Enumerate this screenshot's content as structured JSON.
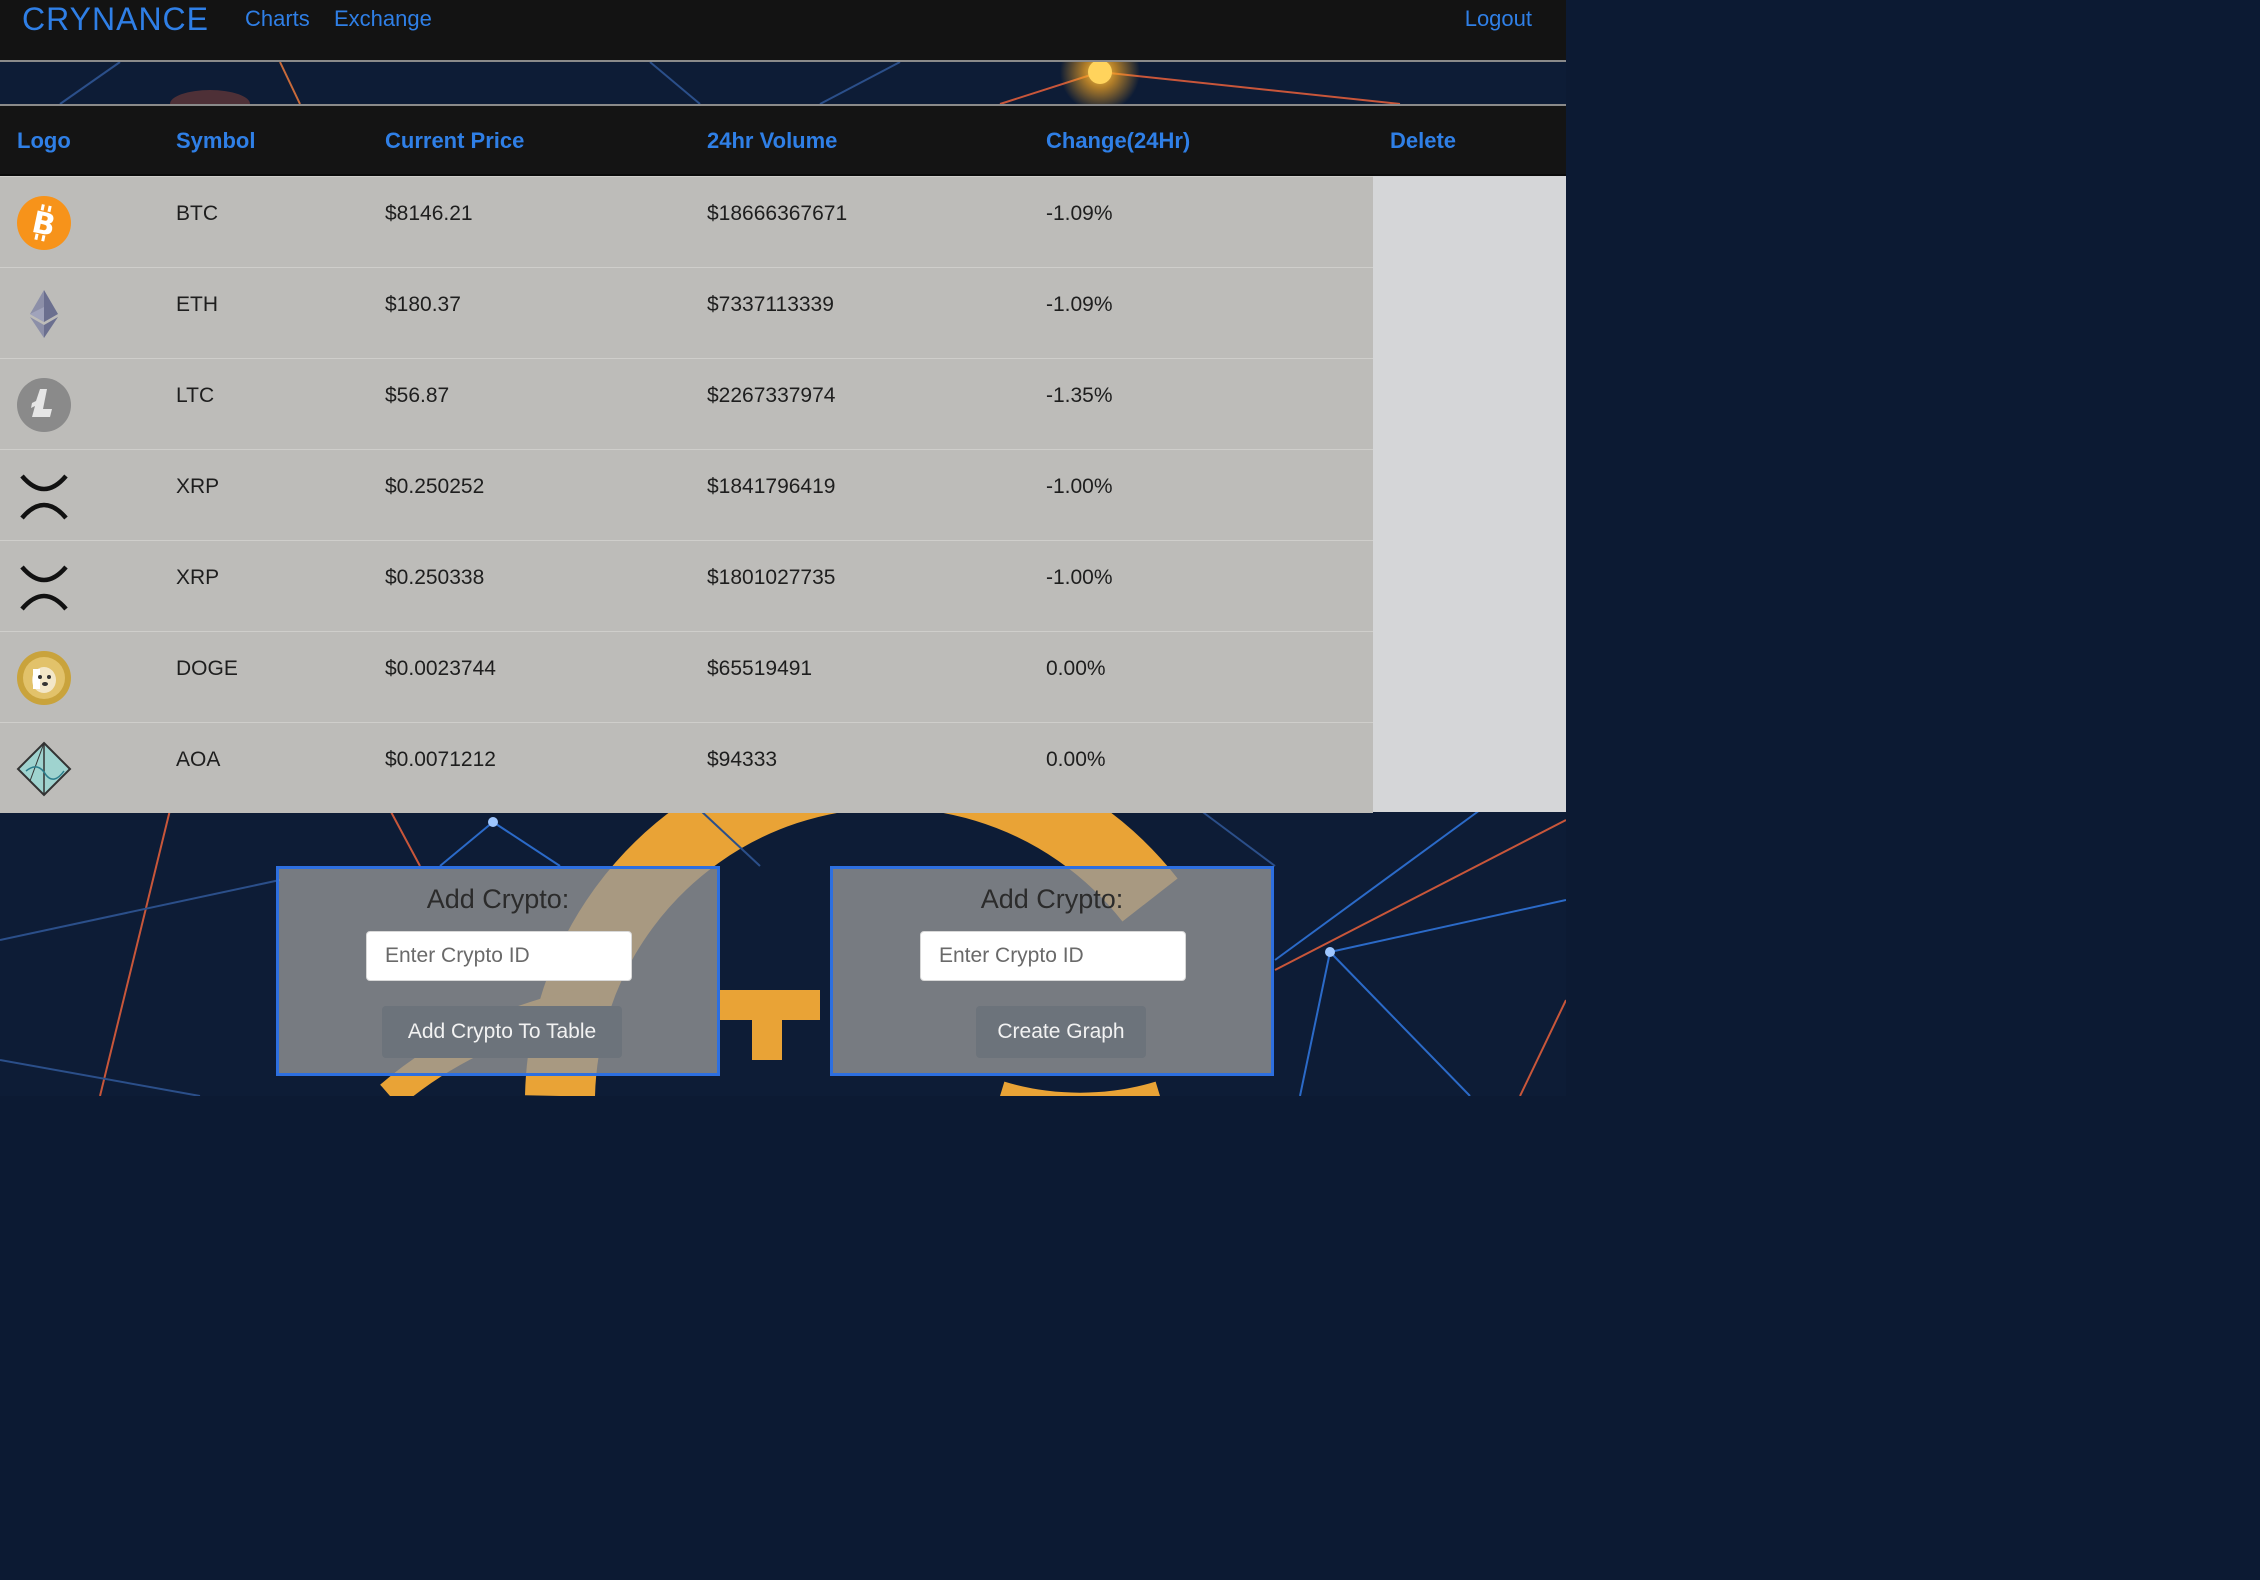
{
  "navbar": {
    "brand": "CRYNANCE",
    "links": {
      "charts": "Charts",
      "exchange": "Exchange",
      "logout": "Logout"
    }
  },
  "table": {
    "headers": {
      "logo": "Logo",
      "symbol": "Symbol",
      "price": "Current Price",
      "volume": "24hr Volume",
      "change": "Change(24Hr)",
      "delete": "Delete"
    },
    "rows": [
      {
        "logo_icon": "bitcoin-icon",
        "symbol": "BTC",
        "price": "$8146.21",
        "volume": "$18666367671",
        "change": "-1.09%"
      },
      {
        "logo_icon": "ethereum-icon",
        "symbol": "ETH",
        "price": "$180.37",
        "volume": "$7337113339",
        "change": "-1.09%"
      },
      {
        "logo_icon": "litecoin-icon",
        "symbol": "LTC",
        "price": "$56.87",
        "volume": "$2267337974",
        "change": "-1.35%"
      },
      {
        "logo_icon": "xrp-icon",
        "symbol": "XRP",
        "price": "$0.250252",
        "volume": "$1841796419",
        "change": "-1.00%"
      },
      {
        "logo_icon": "xrp-icon",
        "symbol": "XRP",
        "price": "$0.250338",
        "volume": "$1801027735",
        "change": "-1.00%"
      },
      {
        "logo_icon": "dogecoin-icon",
        "symbol": "DOGE",
        "price": "$0.0023744",
        "volume": "$65519491",
        "change": "0.00%"
      },
      {
        "logo_icon": "aoa-icon",
        "symbol": "AOA",
        "price": "$0.0071212",
        "volume": "$94333",
        "change": "0.00%"
      }
    ]
  },
  "forms": {
    "add_to_table": {
      "title": "Add Crypto:",
      "placeholder": "Enter Crypto ID",
      "value": "",
      "button": "Add Crypto To Table"
    },
    "create_graph": {
      "title": "Add Crypto:",
      "placeholder": "Enter Crypto ID",
      "value": "",
      "button": "Create Graph"
    }
  },
  "colors": {
    "accent": "#2f7fe6",
    "navbar_bg": "#131313",
    "row_bg": "#bdbcb9",
    "delete_col_bg": "#d5d6d8",
    "form_border": "#2d6fe0",
    "button_bg": "#6c737b",
    "bitcoin_orange": "#f7931a"
  }
}
